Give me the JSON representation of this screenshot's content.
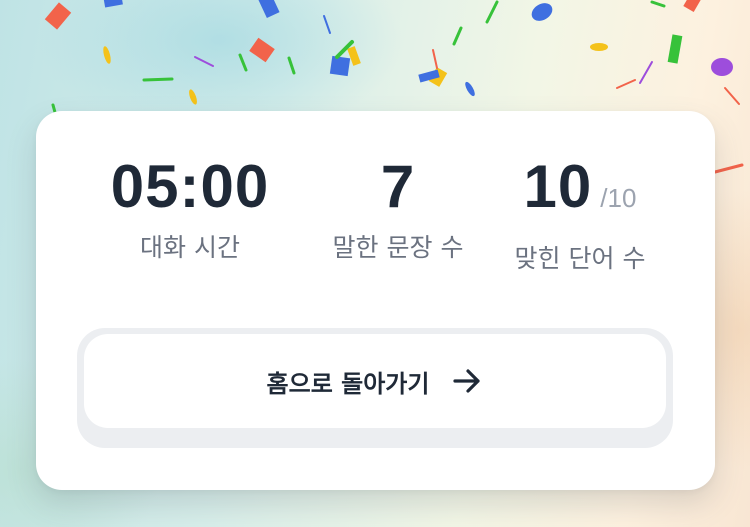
{
  "stats": [
    {
      "value": "05:00",
      "label": "대화 시간"
    },
    {
      "value": "7",
      "label": "말한 문장 수"
    },
    {
      "value": "10",
      "denominator": "/10",
      "label": "맞힌 단어 수"
    }
  ],
  "home_button": {
    "label": "홈으로 돌아가기",
    "icon": "arrow-right-icon"
  },
  "colors": {
    "card": "#ffffff",
    "value_text": "#1f2937",
    "label_text": "#6b7280",
    "button_shell": "#eceef1"
  },
  "confetti_colors": [
    "#f2634a",
    "#3f6fe0",
    "#f4c21a",
    "#37c23a",
    "#9d4ddc"
  ]
}
